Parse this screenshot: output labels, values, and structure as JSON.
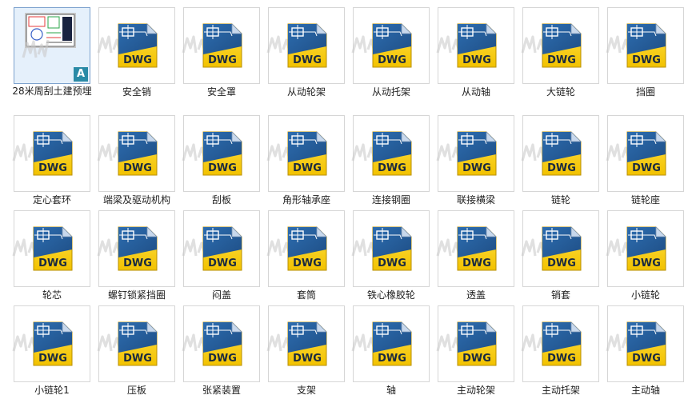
{
  "files": [
    {
      "label": "28米周刮土建预埋",
      "type": "preview",
      "selected": true,
      "badge": "A"
    },
    {
      "label": "安全销",
      "type": "dwg",
      "icon_text": "DWG"
    },
    {
      "label": "安全罩",
      "type": "dwg",
      "icon_text": "DWG"
    },
    {
      "label": "从动轮架",
      "type": "dwg",
      "icon_text": "DWG"
    },
    {
      "label": "从动托架",
      "type": "dwg",
      "icon_text": "DWG"
    },
    {
      "label": "从动轴",
      "type": "dwg",
      "icon_text": "DWG"
    },
    {
      "label": "大链轮",
      "type": "dwg",
      "icon_text": "DWG"
    },
    {
      "label": "挡圈",
      "type": "dwg",
      "icon_text": "DWG"
    },
    {
      "label": "定心套环",
      "type": "dwg",
      "icon_text": "DWG"
    },
    {
      "label": "端梁及驱动机构",
      "type": "dwg",
      "icon_text": "DWG"
    },
    {
      "label": "刮板",
      "type": "dwg",
      "icon_text": "DWG"
    },
    {
      "label": "角形轴承座",
      "type": "dwg",
      "icon_text": "DWG"
    },
    {
      "label": "连接钢圈",
      "type": "dwg",
      "icon_text": "DWG"
    },
    {
      "label": "联接横梁",
      "type": "dwg",
      "icon_text": "DWG"
    },
    {
      "label": "链轮",
      "type": "dwg",
      "icon_text": "DWG"
    },
    {
      "label": "链轮座",
      "type": "dwg",
      "icon_text": "DWG"
    },
    {
      "label": "轮芯",
      "type": "dwg",
      "icon_text": "DWG"
    },
    {
      "label": "螺钉锁紧挡圈",
      "type": "dwg",
      "icon_text": "DWG"
    },
    {
      "label": "闷盖",
      "type": "dwg",
      "icon_text": "DWG"
    },
    {
      "label": "套筒",
      "type": "dwg",
      "icon_text": "DWG"
    },
    {
      "label": "铁心橡胶轮",
      "type": "dwg",
      "icon_text": "DWG"
    },
    {
      "label": "透盖",
      "type": "dwg",
      "icon_text": "DWG"
    },
    {
      "label": "销套",
      "type": "dwg",
      "icon_text": "DWG"
    },
    {
      "label": "小链轮",
      "type": "dwg",
      "icon_text": "DWG"
    },
    {
      "label": "小链轮1",
      "type": "dwg",
      "icon_text": "DWG"
    },
    {
      "label": "压板",
      "type": "dwg",
      "icon_text": "DWG"
    },
    {
      "label": "张紧装置",
      "type": "dwg",
      "icon_text": "DWG"
    },
    {
      "label": "支架",
      "type": "dwg",
      "icon_text": "DWG"
    },
    {
      "label": "轴",
      "type": "dwg",
      "icon_text": "DWG"
    },
    {
      "label": "主动轮架",
      "type": "dwg",
      "icon_text": "DWG"
    },
    {
      "label": "主动托架",
      "type": "dwg",
      "icon_text": "DWG"
    },
    {
      "label": "主动轴",
      "type": "dwg",
      "icon_text": "DWG"
    }
  ],
  "colors": {
    "selection_border": "#7da2ce",
    "selection_fill": "#e5f0fb",
    "dwg_blue": "#1f4f86",
    "dwg_yellow": "#f2c200"
  }
}
